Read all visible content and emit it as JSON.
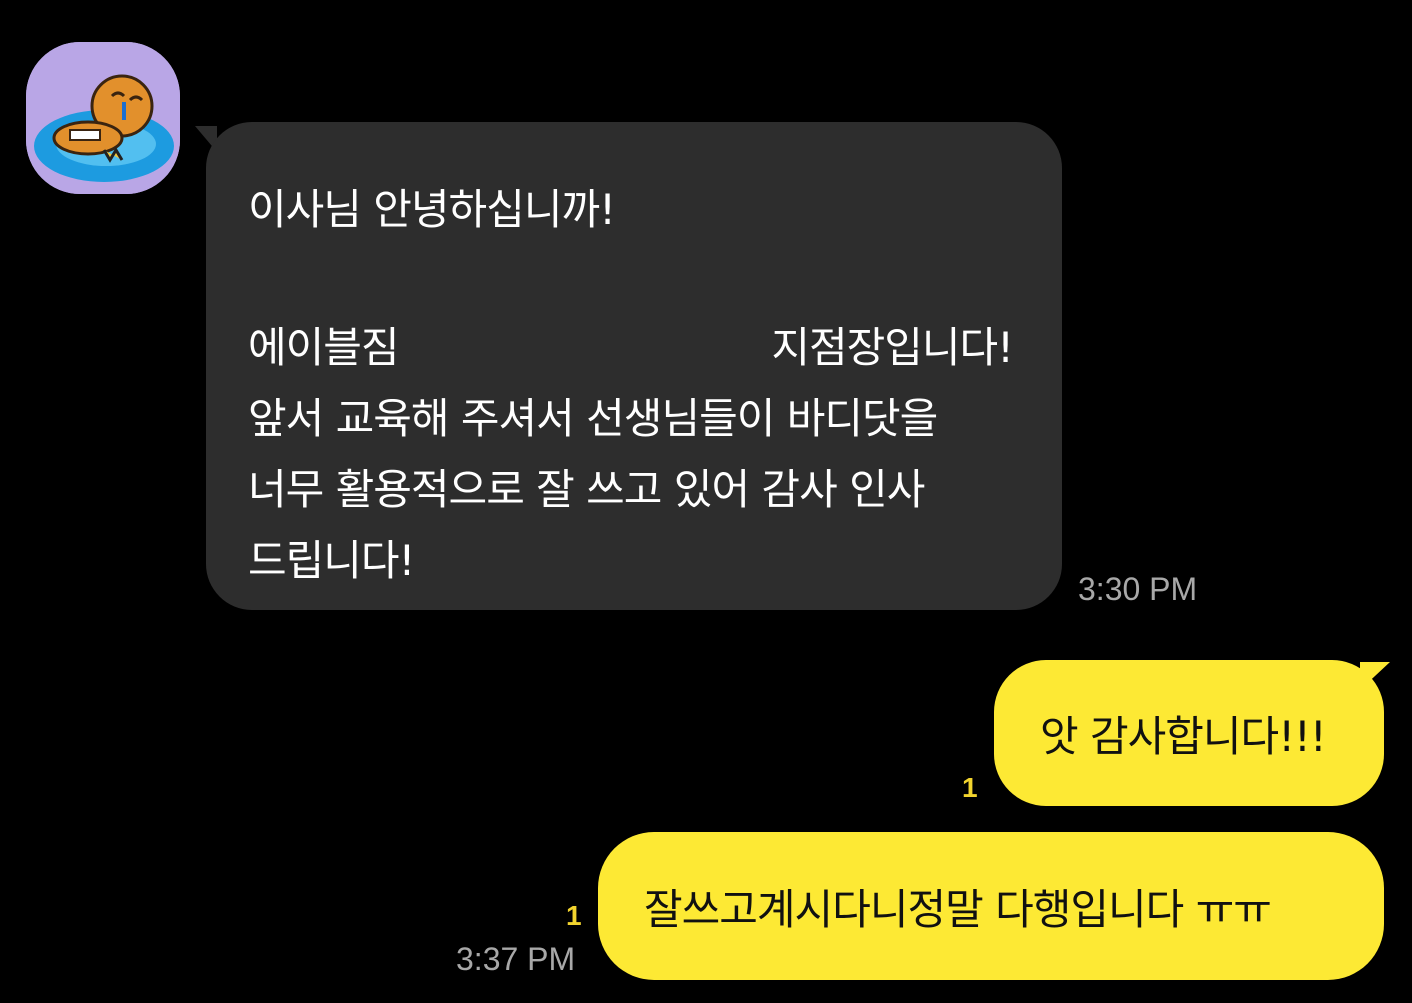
{
  "incoming": {
    "message_lines": [
      "이사님 안녕하십니까!",
      "",
      "에이블짐",
      "지점장입니다!",
      "앞서 교육해 주셔서 선생님들이 바디닷을",
      "너무 활용적으로 잘 쓰고 있어 감사 인사",
      "드립니다!"
    ],
    "time": "3:30 PM"
  },
  "outgoing": [
    {
      "text": "앗 감사합니다!!!",
      "unread": "1"
    },
    {
      "text": "잘쓰고계시다니정말 다행입니다 ㅠㅠ",
      "unread": "1",
      "time": "3:37 PM"
    }
  ],
  "colors": {
    "background": "#000000",
    "incoming_bubble": "#2d2d2d",
    "outgoing_bubble": "#fde934",
    "unread_count": "#f2d42e",
    "timestamp": "#a8a8a8"
  }
}
